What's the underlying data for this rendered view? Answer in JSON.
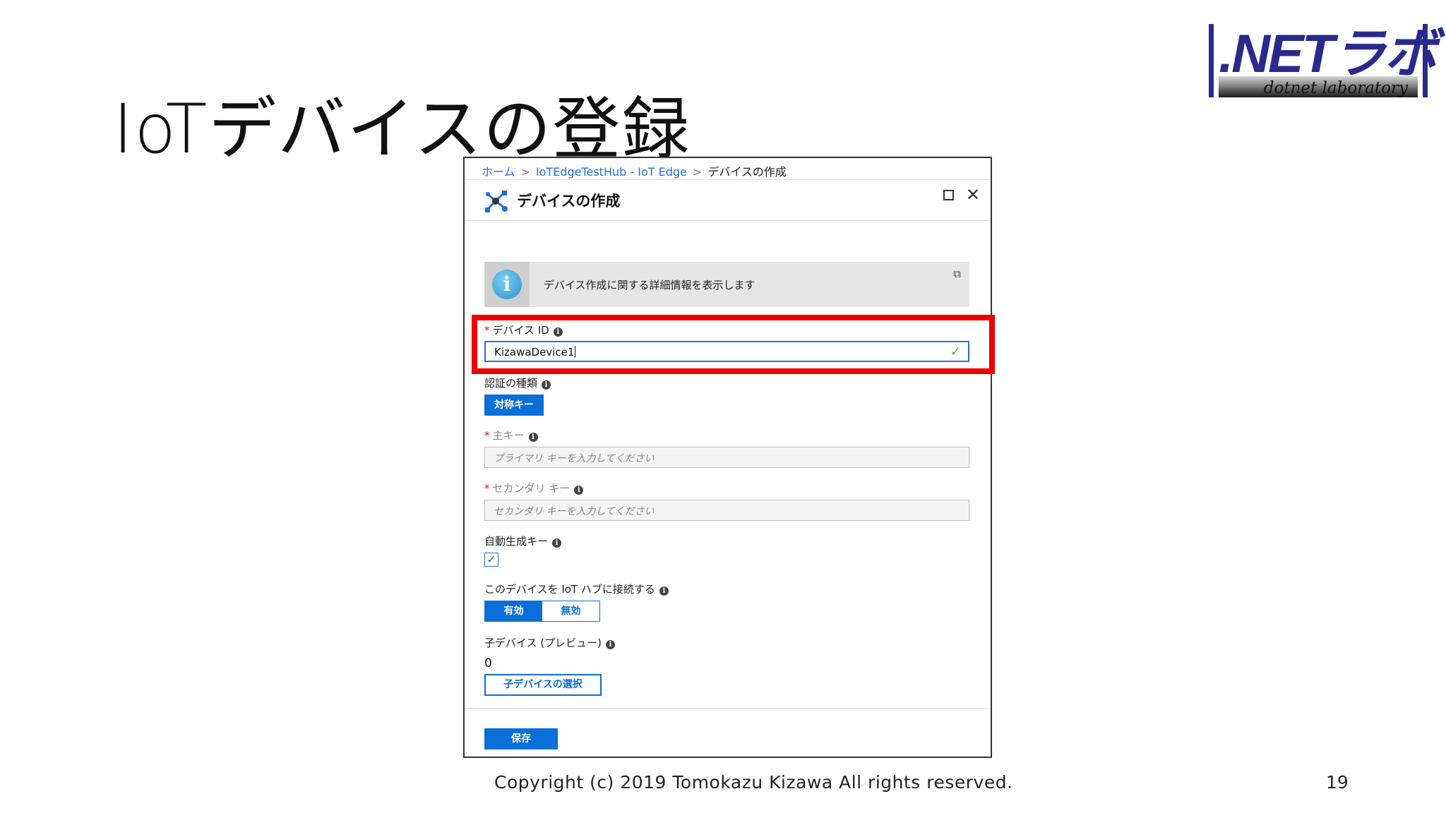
{
  "slide": {
    "title": "IoTデバイスの登録",
    "copyright": "Copyright (c) 2019 Tomokazu Kizawa All rights reserved.",
    "page_number": "19"
  },
  "logo": {
    "main_text": ".NETラボ",
    "sub_text": "dotnet laboratory",
    "colors": {
      "main": "#2a2a8c"
    }
  },
  "panel": {
    "breadcrumb": [
      {
        "label": "ホーム"
      },
      {
        "label": "IoTEdgeTestHub - IoT Edge"
      },
      {
        "label": "デバイスの作成"
      }
    ],
    "breadcrumb_sep": ">",
    "title": "デバイスの作成",
    "title_icon": "device-network-icon",
    "window_controls": {
      "maximize_icon": "maximize-icon",
      "close_glyph": "✕"
    },
    "info_banner": {
      "icon": "info-icon",
      "icon_glyph": "i",
      "text": "デバイス作成に関する詳細情報を表示します",
      "link_icon": "external-link-icon",
      "link_glyph": "⧉"
    },
    "required_mark": "*",
    "info_glyph": "i",
    "fields": {
      "device_id": {
        "label": "デバイス ID",
        "value": "KizawaDevice1",
        "valid_glyph": "✓"
      },
      "auth_type": {
        "label": "認証の種類",
        "selected": "対称キー"
      },
      "primary_key": {
        "label": "主キー",
        "placeholder": "プライマリ キーを入力してください"
      },
      "secondary_key": {
        "label": "セカンダリ キー",
        "placeholder": "セカンダリ キーを入力してください"
      },
      "auto_generate": {
        "label": "自動生成キー",
        "checked_glyph": "✓"
      },
      "connect_hub": {
        "label": "このデバイスを IoT ハブに接続する",
        "on": "有効",
        "off": "無効"
      },
      "child_devices": {
        "label": "子デバイス (プレビュー)",
        "count": "0",
        "select_button": "子デバイスの選択"
      }
    },
    "save_button": "保存",
    "colors": {
      "accent": "#0a6fd8",
      "highlight": "#ee0000",
      "valid": "#4ca93b",
      "link": "#1f6fcf"
    }
  }
}
